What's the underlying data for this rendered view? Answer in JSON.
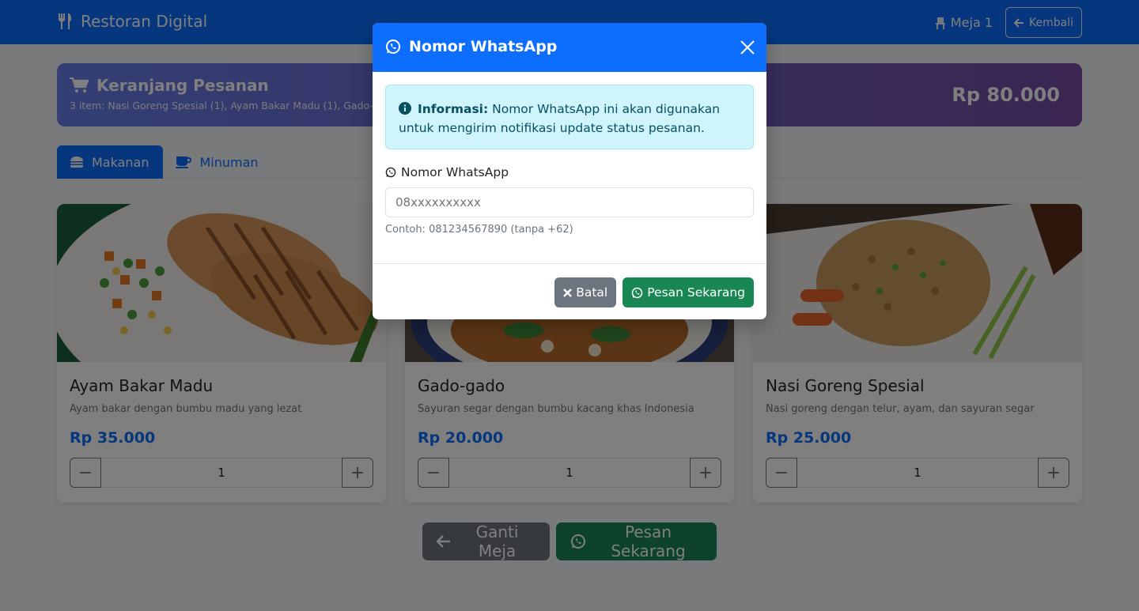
{
  "navbar": {
    "brand": "Restoran Digital",
    "table": "Meja 1",
    "back_label": "Kembali",
    "icons": {
      "brand": "utensils-icon",
      "table": "chair-icon",
      "back": "arrow-left-icon"
    }
  },
  "cart": {
    "title": "Keranjang Pesanan",
    "summary": "3 item: Nasi Goreng Spesial (1), Ayam Bakar Madu (1), Gado-gado (1)",
    "total": "Rp 80.000",
    "icon": "shopping-cart-icon",
    "gradient": [
      "#667eea",
      "#764ba2"
    ]
  },
  "tabs": [
    {
      "label": "Makanan",
      "icon": "burger-icon",
      "active": true
    },
    {
      "label": "Minuman",
      "icon": "coffee-icon",
      "active": false
    }
  ],
  "menu_items": [
    {
      "name": "Ayam Bakar Madu",
      "description": "Ayam bakar dengan bumbu madu yang lezat",
      "price": "Rp 35.000",
      "qty": "1"
    },
    {
      "name": "Gado-gado",
      "description": "Sayuran segar dengan bumbu kacang khas Indonesia",
      "price": "Rp 20.000",
      "qty": "1"
    },
    {
      "name": "Nasi Goreng Spesial",
      "description": "Nasi goreng dengan telur, ayam, dan sayuran segar",
      "price": "Rp 25.000",
      "qty": "1"
    }
  ],
  "bottom": {
    "change_table": "Ganti Meja",
    "order_now": "Pesan Sekarang"
  },
  "modal": {
    "title": "Nomor WhatsApp",
    "info_label": "Informasi:",
    "info_text": " Nomor WhatsApp ini akan digunakan untuk mengirim notifikasi update status pesanan.",
    "field_label": "Nomor WhatsApp",
    "placeholder": "08xxxxxxxxxx",
    "help": "Contoh: 081234567890 (tanpa +62)",
    "cancel": "Batal",
    "submit": "Pesan Sekarang"
  },
  "colors": {
    "primary": "#0d6efd",
    "success": "#198754",
    "secondary": "#6c757d",
    "info_bg": "#cff4fc"
  }
}
